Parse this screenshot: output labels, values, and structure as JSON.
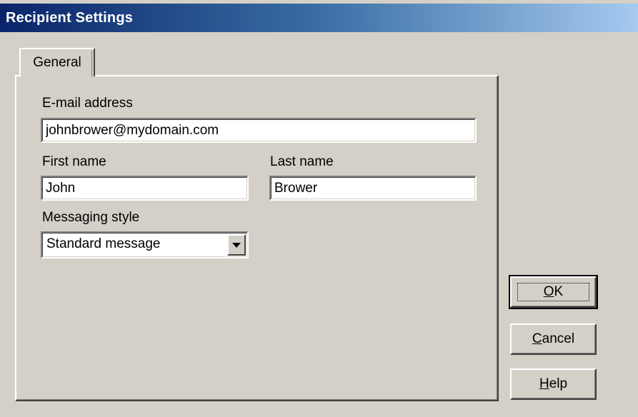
{
  "window": {
    "title": "Recipient Settings"
  },
  "tabs": [
    {
      "label": "General",
      "selected": true
    }
  ],
  "form": {
    "email": {
      "label": "E-mail address",
      "value": "johnbrower@mydomain.com"
    },
    "first_name": {
      "label": "First name",
      "value": "John"
    },
    "last_name": {
      "label": "Last name",
      "value": "Brower"
    },
    "messaging_style": {
      "label": "Messaging style",
      "selected": "Standard message"
    }
  },
  "buttons": {
    "ok": {
      "mnemonic": "O",
      "rest": "K"
    },
    "cancel": {
      "mnemonic": "C",
      "rest": "ancel"
    },
    "help": {
      "mnemonic": "H",
      "rest": "elp"
    }
  }
}
